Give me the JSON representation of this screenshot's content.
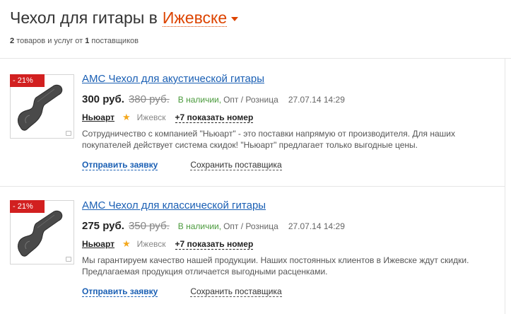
{
  "header": {
    "title": "Чехол для гитары в",
    "city": "Ижевске",
    "summary_count": "2",
    "summary_text1": "товаров и услуг от",
    "summary_suppliers": "1",
    "summary_text2": "поставщиков"
  },
  "listings": [
    {
      "discount": "- 21%",
      "title": "AMC Чехол для акустической гитары",
      "price": "300 руб.",
      "old_price": "380 руб.",
      "stock": "В наличии,",
      "trade": "Опт / Розница",
      "date": "27.07.14 14:29",
      "supplier": "Ньюарт",
      "city": "Ижевск",
      "phone_link": "+7 показать номер",
      "description": "Сотрудничество с компанией \"Ньюарт\" - это поставки напрямую от производителя. Для наших покупателей действует система скидок! \"Ньюарт\" предлагает только выгодные цены.",
      "send_label": "Отправить заявку",
      "save_label": "Сохранить поставщика"
    },
    {
      "discount": "- 21%",
      "title": "AMC Чехол для классической гитары",
      "price": "275 руб.",
      "old_price": "350 руб.",
      "stock": "В наличии,",
      "trade": "Опт / Розница",
      "date": "27.07.14 14:29",
      "supplier": "Ньюарт",
      "city": "Ижевск",
      "phone_link": "+7 показать номер",
      "description": "Мы гарантируем качество нашей продукции. Наших постоянных клиентов в Ижевске ждут скидки. Предлагаемая продукция отличается выгодными расценками.",
      "send_label": "Отправить заявку",
      "save_label": "Сохранить поставщика"
    }
  ],
  "colors": {
    "accent": "#dd4400",
    "link": "#1a5fb4",
    "discount_bg": "#d22020",
    "stock": "#4a9a3c",
    "star": "#f4a81d"
  }
}
